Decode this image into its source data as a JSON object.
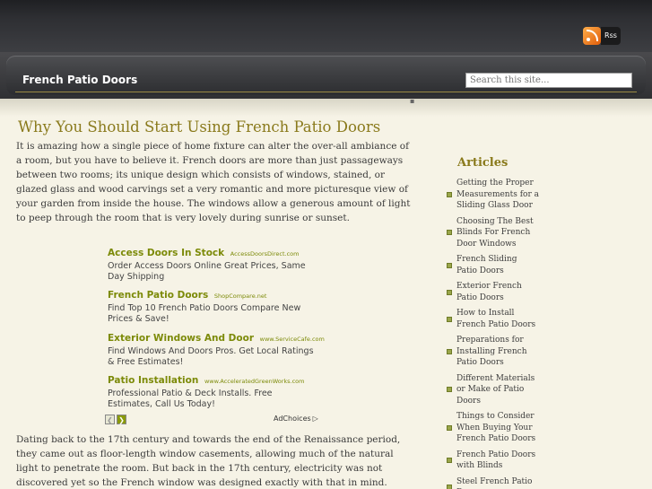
{
  "header": {
    "rss_icon": "rss-feed-icon",
    "rss_label": "Rss"
  },
  "nav": {
    "site_title": "French Patio Doors",
    "search_placeholder": "Search this site..."
  },
  "post": {
    "title": "Why You Should Start Using French Patio Doors",
    "paragraph1": "It is amazing how a single piece of home fixture can alter the over-all ambiance of a room, but you have to believe it. French doors are more than just passageways between two rooms; its unique design which consists of windows, stained, or glazed glass and wood carvings set a very romantic and more picturesque view of your garden from inside the house. The windows allow a generous amount of light to peep through the room that is very lovely during sunrise or sunset.",
    "paragraph2": "Dating back to the 17th century and towards the end of the Renaissance period, they came out as floor-length window casements, allowing much of the natural light to penetrate the room. But back in the 17th century, electricity was not discovered yet so the French window was designed exactly with that in mind."
  },
  "ads": {
    "items": [
      {
        "title": "Access Doors In Stock",
        "url": "AccessDoorsDirect.com",
        "desc": "Order Access Doors Online Great Prices, Same Day Shipping"
      },
      {
        "title": "French Patio Doors",
        "url": "ShopCompare.net",
        "desc": "Find Top 10 French Patio Doors Compare New Prices & Save!"
      },
      {
        "title": "Exterior Windows And Door",
        "url": "www.ServiceCafe.com",
        "desc": "Find Windows And Doors Pros. Get Local Ratings & Free Estimates!"
      },
      {
        "title": "Patio Installation",
        "url": "www.AcceleratedGreenWorks.com",
        "desc": "Professional Patio & Deck Installs. Free Estimates, Call Us Today!"
      }
    ],
    "prev_glyph": "❮",
    "next_glyph": "❯",
    "adchoices_label": "AdChoices"
  },
  "sidebar": {
    "heading": "Articles",
    "items": [
      "Getting the Proper Measurements for a Sliding Glass Door",
      "Choosing The Best Blinds For French Door Windows",
      "French Sliding Patio Doors",
      "Exterior French Patio Doors",
      "How to Install French Patio Doors",
      "Preparations for Installing French Patio Doors",
      "Different Materials or Make of Patio Doors",
      "Things to Consider When Buying Your French Patio Doors",
      "French Patio Doors with Blinds",
      "Steel French Patio Doors"
    ]
  },
  "colors": {
    "title_accent": "#8a7a1c",
    "ad_link": "#7c8a08",
    "background": "#f6f3e6"
  }
}
